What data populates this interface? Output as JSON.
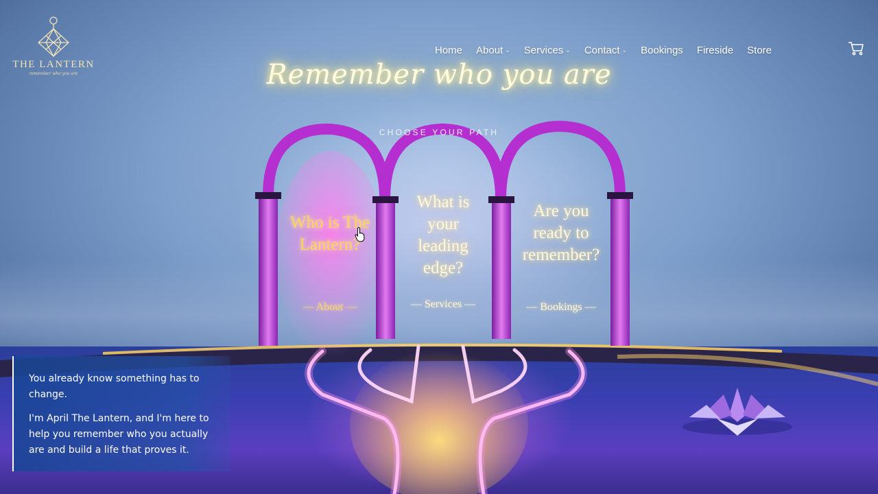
{
  "brand": {
    "name": "THE LANTERN",
    "tagline": "remember who you are"
  },
  "nav": {
    "items": [
      {
        "label": "Home",
        "has_dropdown": false
      },
      {
        "label": "About",
        "has_dropdown": true
      },
      {
        "label": "Services",
        "has_dropdown": true
      },
      {
        "label": "Contact",
        "has_dropdown": true
      },
      {
        "label": "Bookings",
        "has_dropdown": false
      },
      {
        "label": "Fireside",
        "has_dropdown": false
      },
      {
        "label": "Store",
        "has_dropdown": false
      }
    ],
    "cart_icon": "cart-icon"
  },
  "hero": {
    "tagline": "Remember who you are",
    "subtitle": "CHOOSE YOUR PATH"
  },
  "paths": [
    {
      "title": "Who is The Lantern?",
      "link": "— About —"
    },
    {
      "title": "What is your leading edge?",
      "link": "— Services —"
    },
    {
      "title": "Are you ready to remember?",
      "link": "— Bookings —"
    }
  ],
  "intro": {
    "line1": "You already know something has to change.",
    "line2": "I'm April The Lantern, and I'm here to help you remember who you actually are and build a life that proves it."
  },
  "colors": {
    "accent_gold": "#ffd35a",
    "arch_purple": "#b52fd0",
    "intro_box": "#1e4a9a"
  }
}
